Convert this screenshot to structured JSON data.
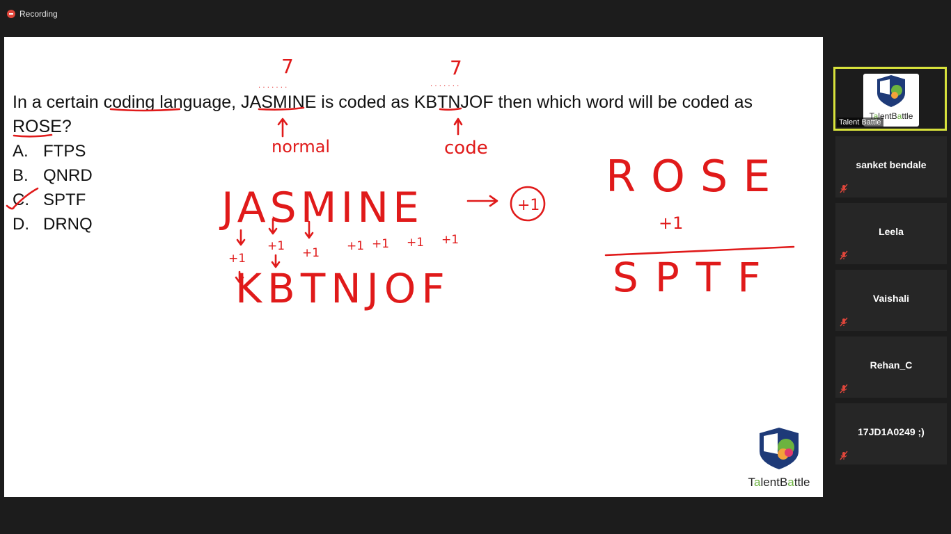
{
  "recording": {
    "label": "Recording"
  },
  "question": {
    "text": "In a certain coding language, JASMINE is coded as KBTNJOF then which word will be coded as ROSE?",
    "options": [
      {
        "letter": "A.",
        "text": "FTPS"
      },
      {
        "letter": "B.",
        "text": "QNRD"
      },
      {
        "letter": "C.",
        "text": "SPTF"
      },
      {
        "letter": "D.",
        "text": "DRNQ"
      }
    ]
  },
  "annotations": {
    "count_left": "7",
    "count_right": "7",
    "label_normal": "normal",
    "label_code": "code",
    "word_top": "JASMINE",
    "arrow_shift": "+1",
    "word_bottom": "KBTNJOF",
    "plus_one": [
      "+1",
      "+1",
      "+1",
      "+1",
      "+1",
      "+1",
      "+1"
    ],
    "rose": "ROSE",
    "rose_plus": "+1",
    "sptf": "SPTF"
  },
  "brand": {
    "name_prefix": "T",
    "name_a": "a",
    "name_mid": "lent",
    "name_b": "B",
    "name_c": "a",
    "name_end": "ttle"
  },
  "participants": {
    "active_tag": "Talent Battle",
    "list": [
      {
        "name": "sanket bendale",
        "muted": true
      },
      {
        "name": "Leela",
        "muted": true
      },
      {
        "name": "Vaishali",
        "muted": true
      },
      {
        "name": "Rehan_C",
        "muted": true
      },
      {
        "name": "17JD1A0249 ;)",
        "muted": true
      }
    ]
  },
  "colors": {
    "ink": "#e01a1a",
    "active_border": "#d8e23c",
    "brand_green": "#6cb33f"
  }
}
